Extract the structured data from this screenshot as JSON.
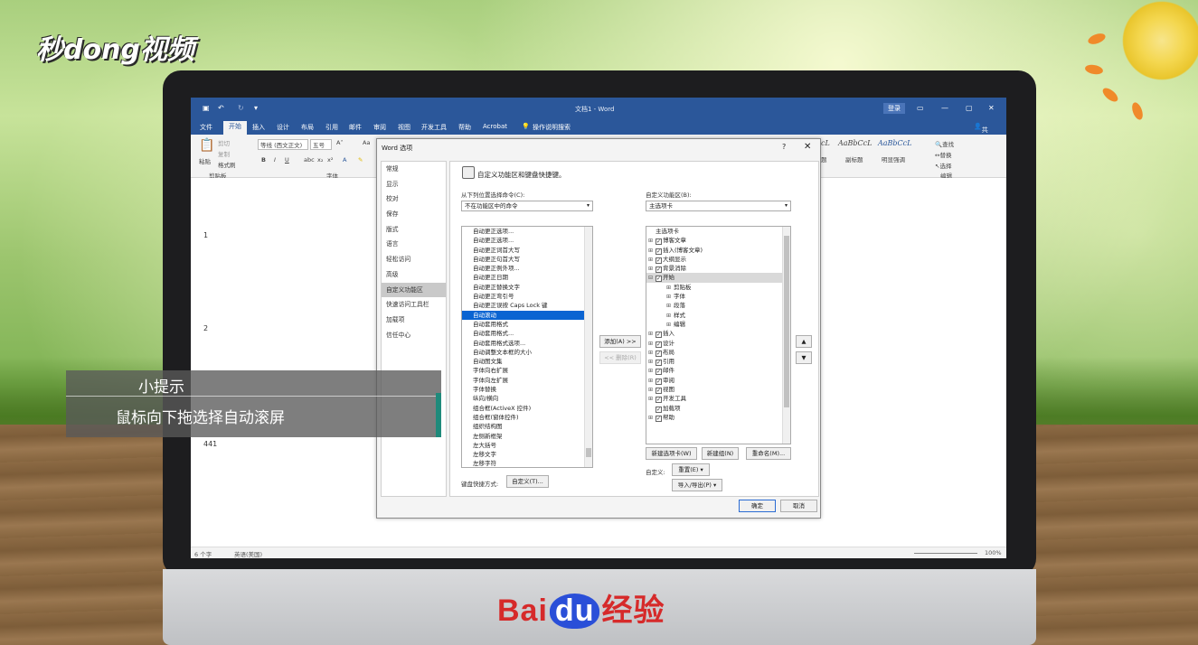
{
  "brand": {
    "logo": "秒dong视频",
    "footer_left": "Bai",
    "footer_du": "du",
    "footer_right": "经验"
  },
  "word": {
    "title": "文档1 - Word",
    "login": "登录",
    "share": "共享",
    "menu": [
      "文件",
      "开始",
      "插入",
      "设计",
      "布局",
      "引用",
      "邮件",
      "审阅",
      "视图",
      "开发工具",
      "帮助",
      "Acrobat",
      "操作说明搜索"
    ],
    "ribbon": {
      "paste": "粘贴",
      "cut": "剪切",
      "copy": "复制",
      "format_painter": "格式刷",
      "clipboard": "剪贴板",
      "font_name": "等线 (西文正文)",
      "font_size": "五号",
      "font_group": "字体",
      "style1_sample": "AaBbCcL",
      "style1": "标题",
      "style2_sample": "AaBbCcL",
      "style2": "副标题",
      "style3_sample": "AaBbCcL",
      "style3": "明显强调",
      "find": "查找",
      "replace": "替换",
      "select": "选择",
      "edit_group": "编辑"
    },
    "page_numbers": [
      "1",
      "2",
      "441"
    ],
    "status": {
      "words": "6 个字",
      "lang": "英语(美国)",
      "zoom": "100%"
    }
  },
  "dialog": {
    "title": "Word 选项",
    "help": "?",
    "close": "✕",
    "nav": [
      "常规",
      "显示",
      "校对",
      "保存",
      "版式",
      "语言",
      "轻松访问",
      "高级",
      "自定义功能区",
      "快速访问工具栏",
      "加载项",
      "信任中心"
    ],
    "nav_selected": 8,
    "header": "自定义功能区和键盘快捷键。",
    "from_label": "从下列位置选择命令(C):",
    "from_value": "不在功能区中的命令",
    "customize_label": "自定义功能区(B):",
    "customize_value": "主选项卡",
    "commands": [
      "自动更正选项...",
      "自动更正选项...",
      "自动更正词首大写",
      "自动更正句首大写",
      "自动更正例外项...",
      "自动更正日期",
      "自动更正替换文字",
      "自动更正弯引号",
      "自动更正误按 Caps Lock 键",
      "自动滚动",
      "自动套用格式",
      "自动套用格式...",
      "自动套用格式选项...",
      "自动调整文本框的大小",
      "自动图文集",
      "字体向右扩展",
      "字体向左扩展",
      "字体替换",
      "纵向/横向",
      "组合框(ActiveX 控件)",
      "组合框(窗体控件)",
      "组织结构图",
      "左侧新框架",
      "左大括号",
      "左移文字",
      "左移字符"
    ],
    "commands_selected": 9,
    "tree": [
      {
        "label": "主选项卡",
        "level": 0,
        "exp": "",
        "chk": false
      },
      {
        "label": "博客文章",
        "level": 0,
        "exp": "⊞",
        "chk": true
      },
      {
        "label": "插入(博客文章)",
        "level": 0,
        "exp": "⊞",
        "chk": true
      },
      {
        "label": "大纲显示",
        "level": 0,
        "exp": "⊞",
        "chk": true
      },
      {
        "label": "背景消除",
        "level": 0,
        "exp": "⊞",
        "chk": true
      },
      {
        "label": "开始",
        "level": 0,
        "exp": "⊟",
        "chk": true
      },
      {
        "label": "剪贴板",
        "level": 1,
        "exp": "⊞",
        "chk": false
      },
      {
        "label": "字体",
        "level": 1,
        "exp": "⊞",
        "chk": false
      },
      {
        "label": "段落",
        "level": 1,
        "exp": "⊞",
        "chk": false
      },
      {
        "label": "样式",
        "level": 1,
        "exp": "⊞",
        "chk": false
      },
      {
        "label": "编辑",
        "level": 1,
        "exp": "⊞",
        "chk": false
      },
      {
        "label": "插入",
        "level": 0,
        "exp": "⊞",
        "chk": true
      },
      {
        "label": "设计",
        "level": 0,
        "exp": "⊞",
        "chk": true
      },
      {
        "label": "布局",
        "level": 0,
        "exp": "⊞",
        "chk": true
      },
      {
        "label": "引用",
        "level": 0,
        "exp": "⊞",
        "chk": true
      },
      {
        "label": "邮件",
        "level": 0,
        "exp": "⊞",
        "chk": true
      },
      {
        "label": "审阅",
        "level": 0,
        "exp": "⊞",
        "chk": true
      },
      {
        "label": "视图",
        "level": 0,
        "exp": "⊞",
        "chk": true
      },
      {
        "label": "开发工具",
        "level": 0,
        "exp": "⊞",
        "chk": true
      },
      {
        "label": "加载项",
        "level": 0,
        "exp": "",
        "chk": true
      },
      {
        "label": "帮助",
        "level": 0,
        "exp": "⊞",
        "chk": true
      }
    ],
    "add_btn": "添加(A) >>",
    "remove_btn": "<< 删除(R)",
    "new_tab": "新建选项卡(W)",
    "new_group": "新建组(N)",
    "rename": "重命名(M)...",
    "customize_colon": "自定义:",
    "reset": "重置(E) ▾",
    "import_export": "导入/导出(P) ▾",
    "kbd_label": "键盘快捷方式:",
    "kbd_btn": "自定义(T)...",
    "ok": "确定",
    "cancel": "取消"
  },
  "tip": {
    "title": "小提示",
    "body": "鼠标向下拖选择自动滚屏"
  }
}
